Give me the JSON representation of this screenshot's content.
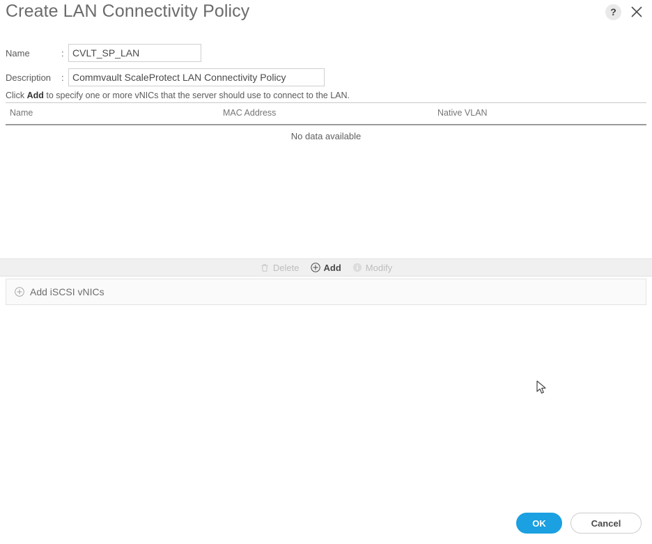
{
  "dialog": {
    "title": "Create LAN Connectivity Policy",
    "help_icon": "help-question-icon",
    "close_icon": "close-icon"
  },
  "form": {
    "name": {
      "label": "Name",
      "separator": ":",
      "value": "CVLT_SP_LAN",
      "placeholder": ""
    },
    "description": {
      "label": "Description",
      "separator": ":",
      "value": "Commvault ScaleProtect LAN Connectivity Policy",
      "placeholder": ""
    }
  },
  "hint": {
    "prefix": "Click ",
    "bold": "Add",
    "suffix": " to specify one or more vNICs that the server should use to connect to the LAN."
  },
  "table": {
    "columns": [
      "Name",
      "MAC Address",
      "Native VLAN"
    ],
    "rows": [],
    "empty_message": "No data available"
  },
  "toolbar": {
    "buttons": [
      {
        "label": "Delete",
        "icon": "trash-icon",
        "state": "disabled"
      },
      {
        "label": "Add",
        "icon": "plus-circle-icon",
        "state": "active"
      },
      {
        "label": "Modify",
        "icon": "info-circle-icon",
        "state": "disabled"
      }
    ]
  },
  "iscsi": {
    "label": "Add iSCSI vNICs",
    "icon": "plus-circle-icon"
  },
  "footer": {
    "ok_label": "OK",
    "cancel_label": "Cancel"
  },
  "colors": {
    "accent_blue": "#1ba0e1",
    "toolbar_grey": "#f0f0f0",
    "text_grey": "#4a4a4a",
    "disabled_grey": "#bdbdbd"
  }
}
